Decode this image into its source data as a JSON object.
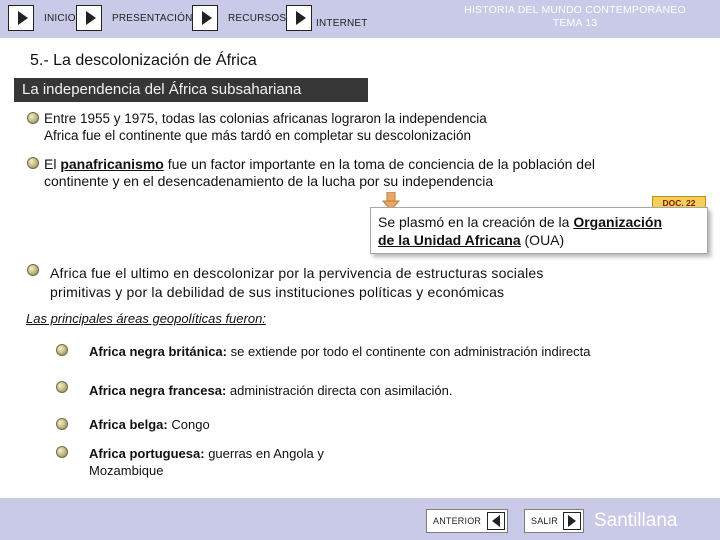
{
  "header": {
    "nav": [
      {
        "label": "INICIO",
        "icon": "play-icon"
      },
      {
        "label": "PRESENTACIÓN",
        "icon": "play-icon"
      },
      {
        "label": "RECURSOS",
        "icon": "play-icon"
      },
      {
        "label": "INTERNET",
        "icon": "play-icon"
      }
    ],
    "title_line1": "HISTORIA DEL MUNDO CONTEMPORÁNEO",
    "title_line2": "TEMA 13"
  },
  "content": {
    "section_title": "5.- La descolonización de África",
    "subheading": "La independencia del África subsahariana",
    "p1": "Entre 1955 y 1975, todas las colonias africanas lograron la independencia",
    "p1b": "Africa fue el continente que más tardó en completar su descolonización",
    "p2_bold": "panafricanismo",
    "p2_pre": "El ",
    "p2_post": " fue un factor importante en la toma de conciencia de la población del",
    "p2_line2": "continente y en el desencadenamiento de la lucha por su independencia",
    "doc_badge": "DOC. 22",
    "callout_pre": "Se plasmó en la creación de la ",
    "callout_link1": "Organización",
    "callout_link2": "de la Unidad Africana",
    "callout_post": " (OUA)",
    "p3_line1": "Africa fue el ultimo en descolonizar por la pervivencia de estructuras sociales",
    "p3_line2": "primitivas y por la debilidad de sus instituciones políticas y económicas",
    "areas_title": "Las principales áreas geopolíticas fueron:",
    "areas": [
      {
        "name": "Africa negra británica:",
        "desc": " se extiende por todo el continente con administración indirecta"
      },
      {
        "name": "Africa negra francesa:",
        "desc": " administración directa con asimilación."
      },
      {
        "name": "Africa belga:",
        "desc": " Congo"
      },
      {
        "name": "Africa portuguesa:",
        "desc": " guerras en Angola y",
        "desc2": "Mozambique"
      }
    ]
  },
  "footer": {
    "prev_label": "ANTERIOR",
    "exit_label": "SALIR",
    "brand": "Santillana"
  },
  "colors": {
    "bar": "#c9c9e8",
    "subheading_bg": "#363636",
    "doc_badge": "#f4d05a"
  }
}
